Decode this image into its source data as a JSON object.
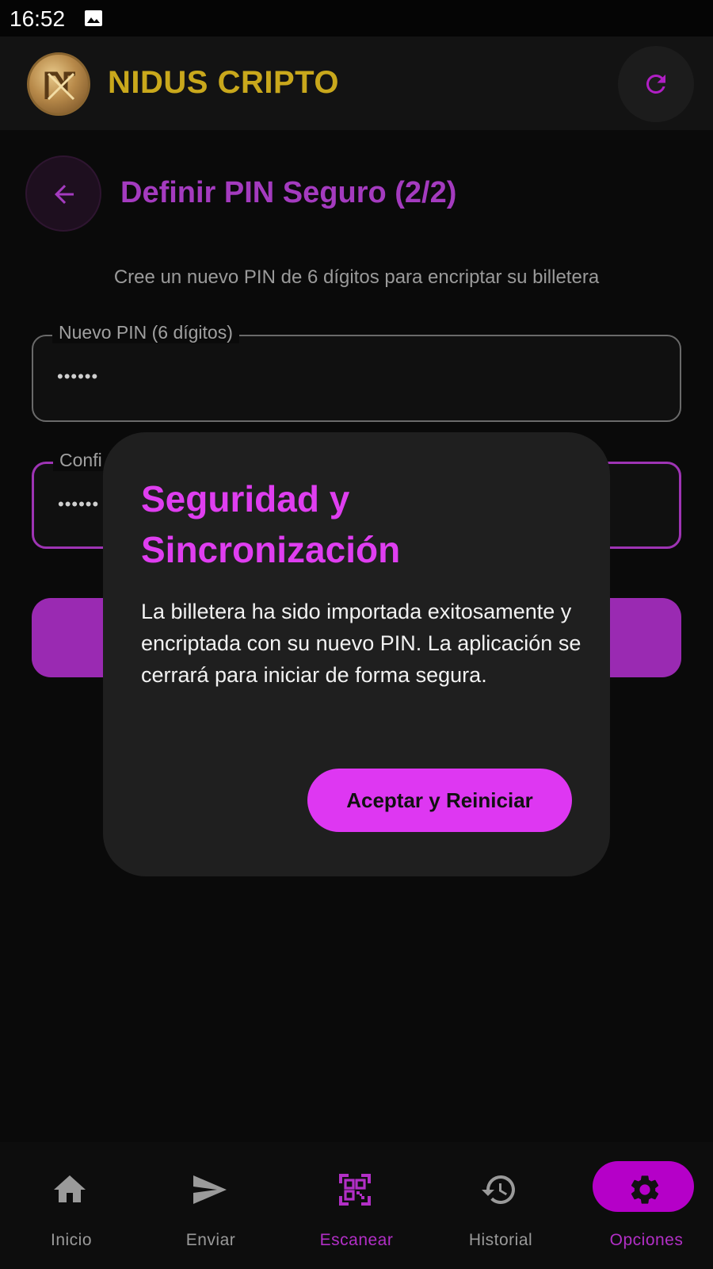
{
  "status_bar": {
    "time": "16:52"
  },
  "header": {
    "app_title": "NIDUS CRIPTO"
  },
  "page": {
    "title": "Definir PIN Seguro (2/2)",
    "subtitle": "Cree un nuevo PIN de 6 dígitos para encriptar su billetera",
    "new_pin": {
      "label": "Nuevo PIN (6 dígitos)",
      "value": "••••••"
    },
    "confirm_pin": {
      "label": "Confi",
      "value": "••••••"
    }
  },
  "dialog": {
    "title": "Seguridad y Sincronización",
    "body": "La billetera ha sido importada exitosamente y encriptada con su nuevo PIN. La aplicación se cerrará para iniciar de forma segura.",
    "button_label": "Aceptar y Reiniciar"
  },
  "bottom_nav": {
    "items": [
      {
        "label": "Inicio",
        "icon": "home-icon"
      },
      {
        "label": "Enviar",
        "icon": "send-icon"
      },
      {
        "label": "Escanear",
        "icon": "qr-scan-icon"
      },
      {
        "label": "Historial",
        "icon": "history-icon"
      },
      {
        "label": "Opciones",
        "icon": "settings-icon",
        "selected": true
      }
    ]
  },
  "colors": {
    "brand_gold": "#c9a81c",
    "accent_purple": "#a43bbf",
    "dialog_accent": "#de37f2",
    "selected_nav": "#b500c8"
  }
}
